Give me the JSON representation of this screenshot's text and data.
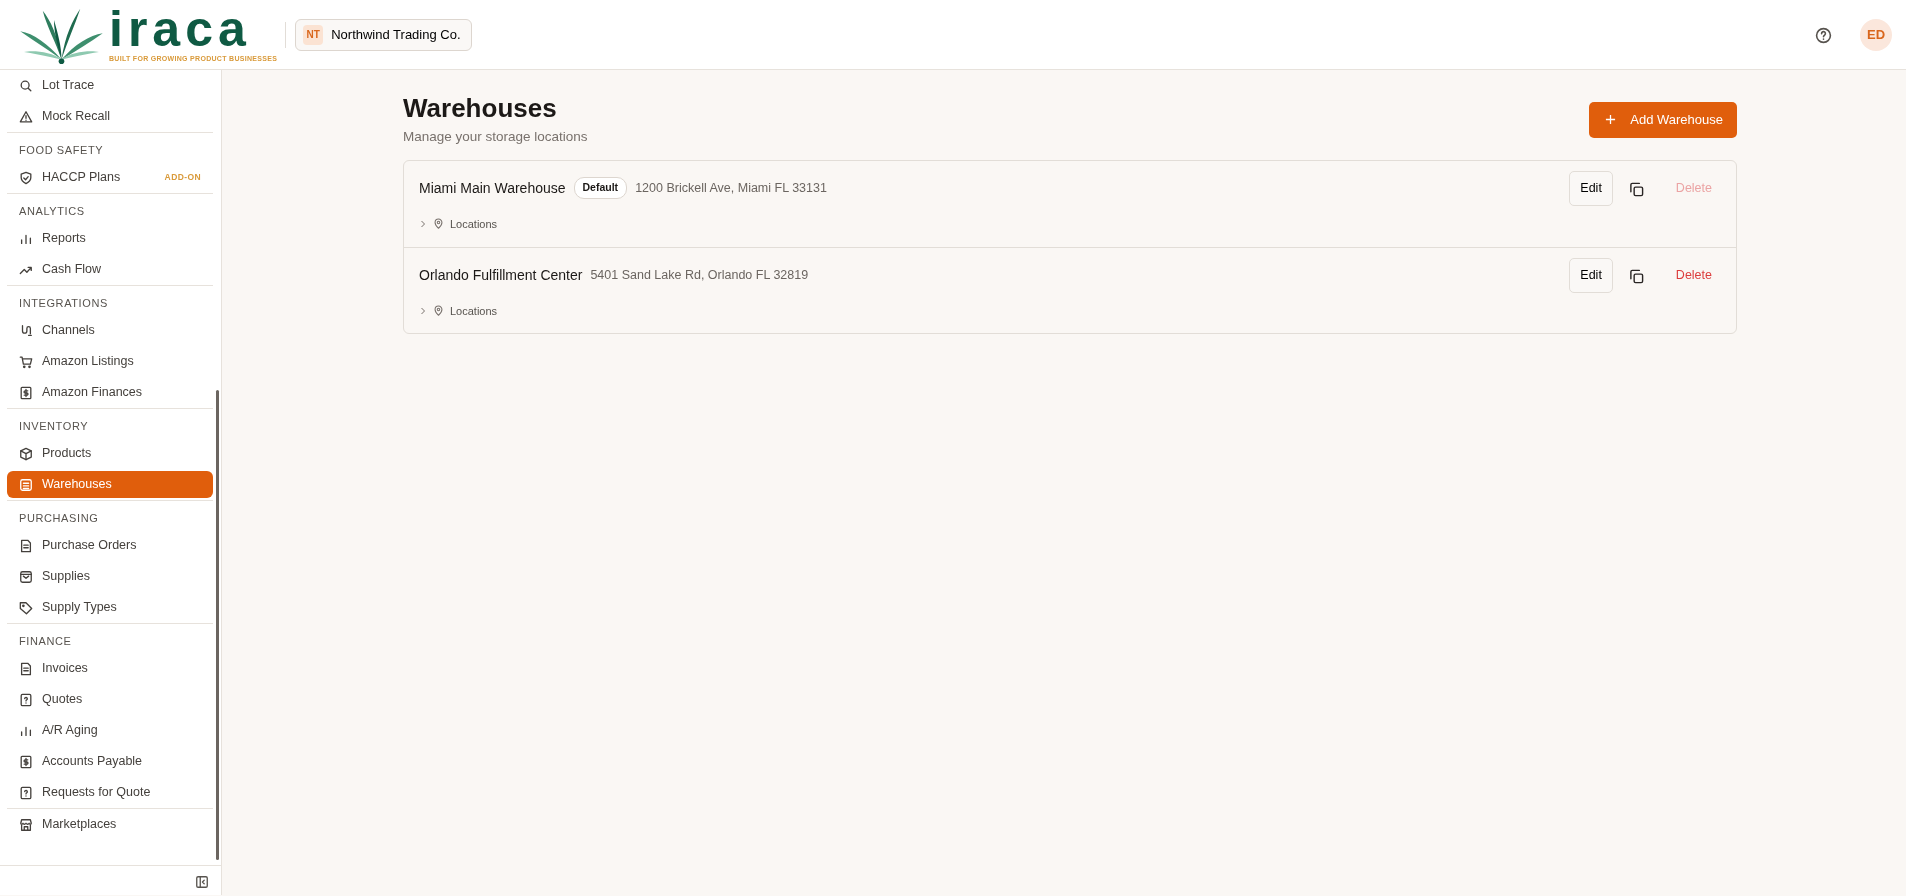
{
  "brand": {
    "name": "iraca",
    "tagline": "BUILT FOR GROWING PRODUCT BUSINESSES"
  },
  "org": {
    "initials": "NT",
    "name": "Northwind Trading Co."
  },
  "user": {
    "initials": "ED"
  },
  "sidebar": {
    "groups": [
      {
        "items": [
          {
            "label": "Lot Trace",
            "selected": false
          },
          {
            "label": "Mock Recall",
            "selected": false
          }
        ]
      },
      {
        "title": "FOOD SAFETY",
        "items": [
          {
            "label": "HACCP Plans",
            "selected": false,
            "tag": "ADD-ON"
          }
        ]
      },
      {
        "title": "ANALYTICS",
        "items": [
          {
            "label": "Reports",
            "selected": false
          },
          {
            "label": "Cash Flow",
            "selected": false
          }
        ]
      },
      {
        "title": "INTEGRATIONS",
        "items": [
          {
            "label": "Channels",
            "selected": false
          },
          {
            "label": "Amazon Listings",
            "selected": false
          },
          {
            "label": "Amazon Finances",
            "selected": false
          }
        ]
      },
      {
        "title": "INVENTORY",
        "items": [
          {
            "label": "Products",
            "selected": false
          },
          {
            "label": "Warehouses",
            "selected": true
          }
        ]
      },
      {
        "title": "PURCHASING",
        "items": [
          {
            "label": "Purchase Orders",
            "selected": false
          },
          {
            "label": "Supplies",
            "selected": false
          },
          {
            "label": "Supply Types",
            "selected": false
          }
        ]
      },
      {
        "title": "FINANCE",
        "items": [
          {
            "label": "Invoices",
            "selected": false
          },
          {
            "label": "Quotes",
            "selected": false
          },
          {
            "label": "A/R Aging",
            "selected": false
          },
          {
            "label": "Accounts Payable",
            "selected": false
          },
          {
            "label": "Requests for Quote",
            "selected": false
          }
        ]
      },
      {
        "items": [
          {
            "label": "Marketplaces",
            "selected": false
          }
        ]
      }
    ]
  },
  "page": {
    "title": "Warehouses",
    "subtitle": "Manage your storage locations",
    "add_button": "Add Warehouse"
  },
  "warehouses": [
    {
      "name": "Miami Main Warehouse",
      "badge": "Default",
      "address": "1200 Brickell Ave, Miami FL 33131",
      "locations": "Locations",
      "expanded": false,
      "edit": "Edit",
      "delete": "Delete",
      "delete_disabled": true
    },
    {
      "name": "Orlando Fulfillment Center",
      "address": "5401 Sand Lake Rd, Orlando FL 32819",
      "locations": "Locations",
      "expanded": false,
      "edit": "Edit",
      "delete": "Delete",
      "delete_disabled": false
    }
  ]
}
